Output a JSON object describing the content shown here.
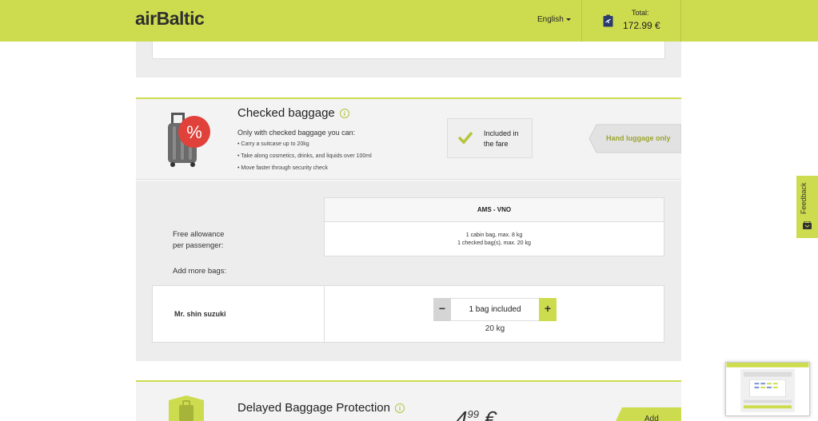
{
  "header": {
    "logo": "airBaltic",
    "language": "English",
    "total_label": "Total:",
    "total_value": "172.99 €"
  },
  "checked_baggage": {
    "title": "Checked baggage",
    "subtitle": "Only with checked baggage you can:",
    "bullets": [
      "• Carry a suitcase up to 20kg",
      "• Take along cosmetics, drinks, and liquids over 100ml",
      "• Move faster through security check"
    ],
    "included_line1": "Included in",
    "included_line2": "the fare",
    "hand_luggage_label": "Hand luggage only",
    "route": "AMS - VNO",
    "allowance_label_line1": "Free allowance",
    "allowance_label_line2": "per passenger:",
    "allowance_line1": "1 cabin bag, max. 8 kg",
    "allowance_line2": "1 checked bag(s), max. 20 kg",
    "add_more_label": "Add more bags:",
    "passenger_name": "Mr. shin suzuki",
    "minus_label": "−",
    "stepper_value": "1 bag included",
    "plus_label": "+",
    "weight": "20 kg"
  },
  "delayed_baggage": {
    "title": "Delayed Baggage Protection",
    "price_main": "4",
    "price_cents": "99",
    "price_currency": "€",
    "add_label": "Add"
  },
  "feedback": {
    "label": "Feedback"
  },
  "colors": {
    "brand": "#cddc4e",
    "accent_red": "#e0413a"
  }
}
